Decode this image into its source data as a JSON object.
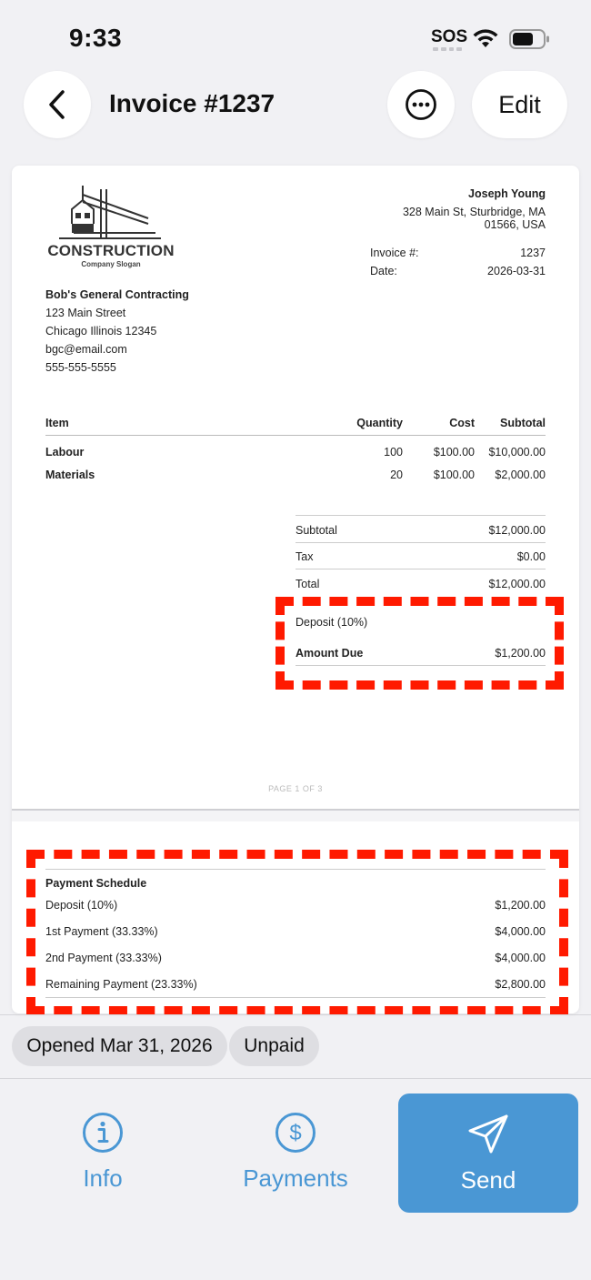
{
  "status_bar": {
    "time": "9:33",
    "sos": "SOS"
  },
  "nav": {
    "title": "Invoice #1237",
    "edit_label": "Edit"
  },
  "document": {
    "logo": {
      "word": "CONSTRUCTION",
      "slogan": "Company Slogan"
    },
    "client": {
      "name": "Joseph Young",
      "address_line1": "328 Main St, Sturbridge, MA",
      "address_line2": "01566, USA"
    },
    "meta": {
      "invoice_label": "Invoice #:",
      "invoice_value": "1237",
      "date_label": "Date:",
      "date_value": "2026-03-31"
    },
    "company": {
      "name": "Bob's General Contracting",
      "street": "123 Main Street",
      "city": "Chicago Illinois 12345",
      "email": "bgc@email.com",
      "phone": "555-555-5555"
    },
    "items_table": {
      "headers": {
        "item": "Item",
        "quantity": "Quantity",
        "cost": "Cost",
        "subtotal": "Subtotal"
      },
      "rows": [
        {
          "item": "Labour",
          "quantity": "100",
          "cost": "$100.00",
          "subtotal": "$10,000.00"
        },
        {
          "item": "Materials",
          "quantity": "20",
          "cost": "$100.00",
          "subtotal": "$2,000.00"
        }
      ]
    },
    "totals": {
      "subtotal_label": "Subtotal",
      "subtotal_value": "$12,000.00",
      "tax_label": "Tax",
      "tax_value": "$0.00",
      "total_label": "Total",
      "total_value": "$12,000.00",
      "deposit_label": "Deposit (10%)",
      "amount_due_label": "Amount Due",
      "amount_due_value": "$1,200.00"
    },
    "page_footer": "PAGE 1 OF 3",
    "payment_schedule": {
      "title": "Payment Schedule",
      "rows": [
        {
          "label": "Deposit (10%)",
          "value": "$1,200.00"
        },
        {
          "label": "1st Payment (33.33%)",
          "value": "$4,000.00"
        },
        {
          "label": "2nd Payment (33.33%)",
          "value": "$4,000.00"
        },
        {
          "label": "Remaining Payment (23.33%)",
          "value": "$2,800.00"
        }
      ]
    }
  },
  "status_chips": {
    "opened": "Opened Mar 31, 2026",
    "payment_status": "Unpaid"
  },
  "bottom_bar": {
    "info_label": "Info",
    "payments_label": "Payments",
    "send_label": "Send"
  },
  "colors": {
    "accent": "#4a97d4",
    "highlight": "#ff1a00",
    "background": "#f1f1f4"
  },
  "icons": [
    "chevron-left-icon",
    "ellipsis-circle-icon",
    "wifi-icon",
    "battery-icon",
    "info-circle-icon",
    "dollar-circle-icon",
    "paper-plane-icon"
  ]
}
